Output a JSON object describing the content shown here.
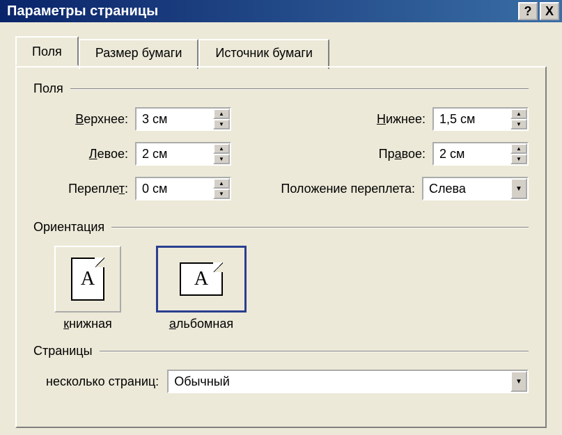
{
  "titlebar": {
    "title": "Параметры страницы",
    "help": "?",
    "close": "X"
  },
  "tabs": {
    "fields": "Поля",
    "paper_size": "Размер бумаги",
    "paper_source": "Источник бумаги"
  },
  "groups": {
    "margins": "Поля",
    "orientation": "Ориентация",
    "pages": "Страницы"
  },
  "margins": {
    "top_label": "Верхнее:",
    "top_value": "3 см",
    "bottom_label_pre": "Н",
    "bottom_label_post": "ижнее:",
    "bottom_value": "1,5 см",
    "left_label": "Левое:",
    "left_value": "2 см",
    "right_label": "Правое:",
    "right_value": "2 см",
    "gutter_label_pre": "Перепле",
    "gutter_label_post": "т:",
    "gutter_value": "0 см",
    "gutter_pos_label": "Положение переплета:",
    "gutter_pos_value": "Слева"
  },
  "orientation": {
    "portrait_pre": "к",
    "portrait_post": "нижная",
    "landscape": "альбомная",
    "glyph": "A"
  },
  "pages": {
    "multiple_label": "несколько страниц:",
    "multiple_value": "Обычный"
  }
}
